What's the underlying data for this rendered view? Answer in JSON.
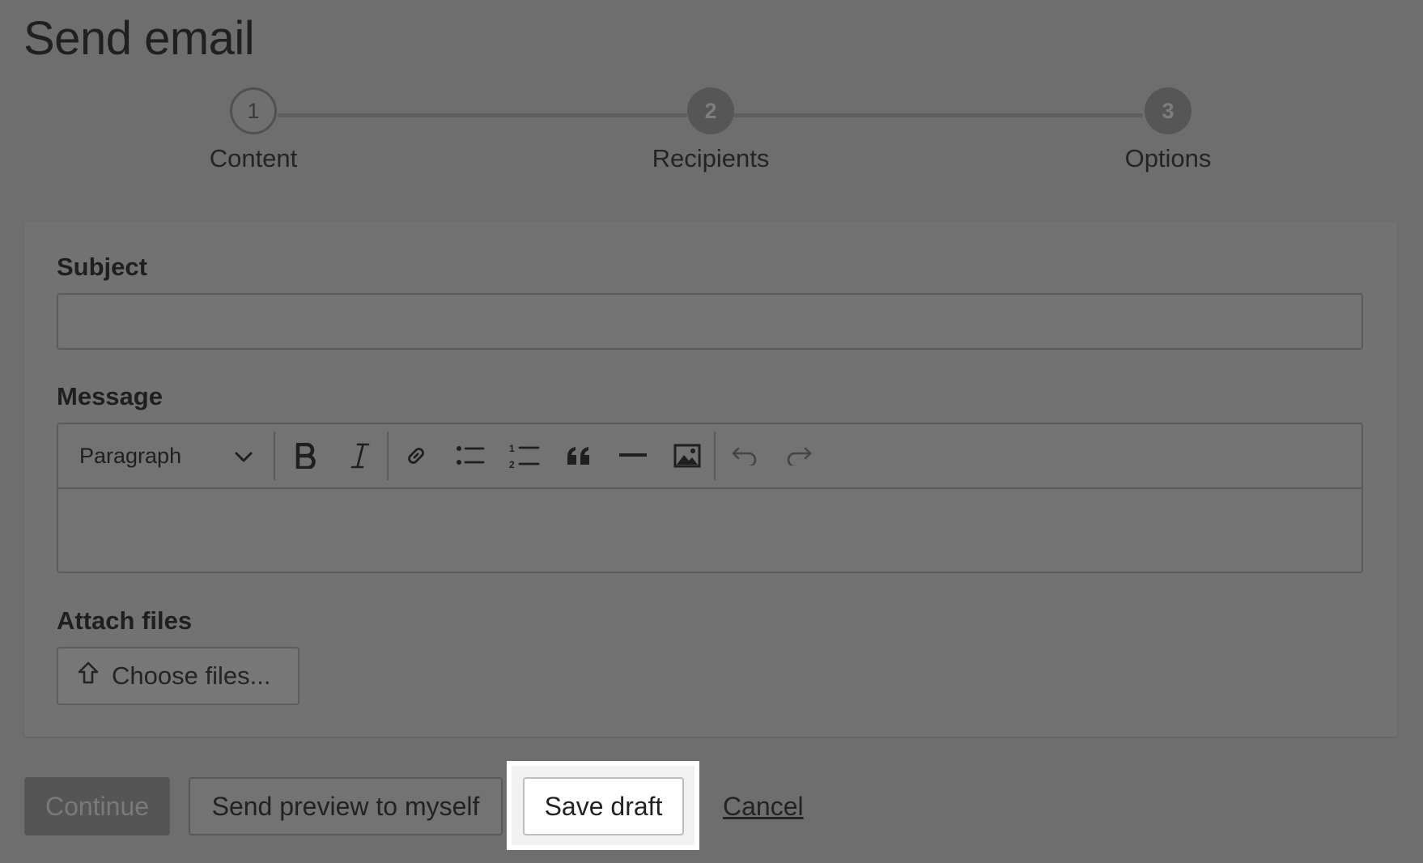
{
  "page": {
    "title": "Send email"
  },
  "stepper": {
    "steps": [
      {
        "number": "1",
        "label": "Content",
        "state": "current"
      },
      {
        "number": "2",
        "label": "Recipients",
        "state": "upcoming"
      },
      {
        "number": "3",
        "label": "Options",
        "state": "upcoming"
      }
    ]
  },
  "form": {
    "subject": {
      "label": "Subject",
      "value": "",
      "placeholder": ""
    },
    "message": {
      "label": "Message",
      "format_selected": "Paragraph",
      "toolbar": [
        "bold-icon",
        "italic-icon",
        "link-icon",
        "bulleted-list-icon",
        "numbered-list-icon",
        "blockquote-icon",
        "horizontal-rule-icon",
        "image-icon",
        "undo-icon",
        "redo-icon"
      ],
      "value": ""
    },
    "attachments": {
      "label": "Attach files",
      "button_label": "Choose files..."
    }
  },
  "actions": {
    "continue_label": "Continue",
    "preview_label": "Send preview to myself",
    "save_draft_label": "Save draft",
    "cancel_label": "Cancel"
  },
  "colors": {
    "overlay": "#6e6e6e",
    "highlight": "#ffffff"
  }
}
